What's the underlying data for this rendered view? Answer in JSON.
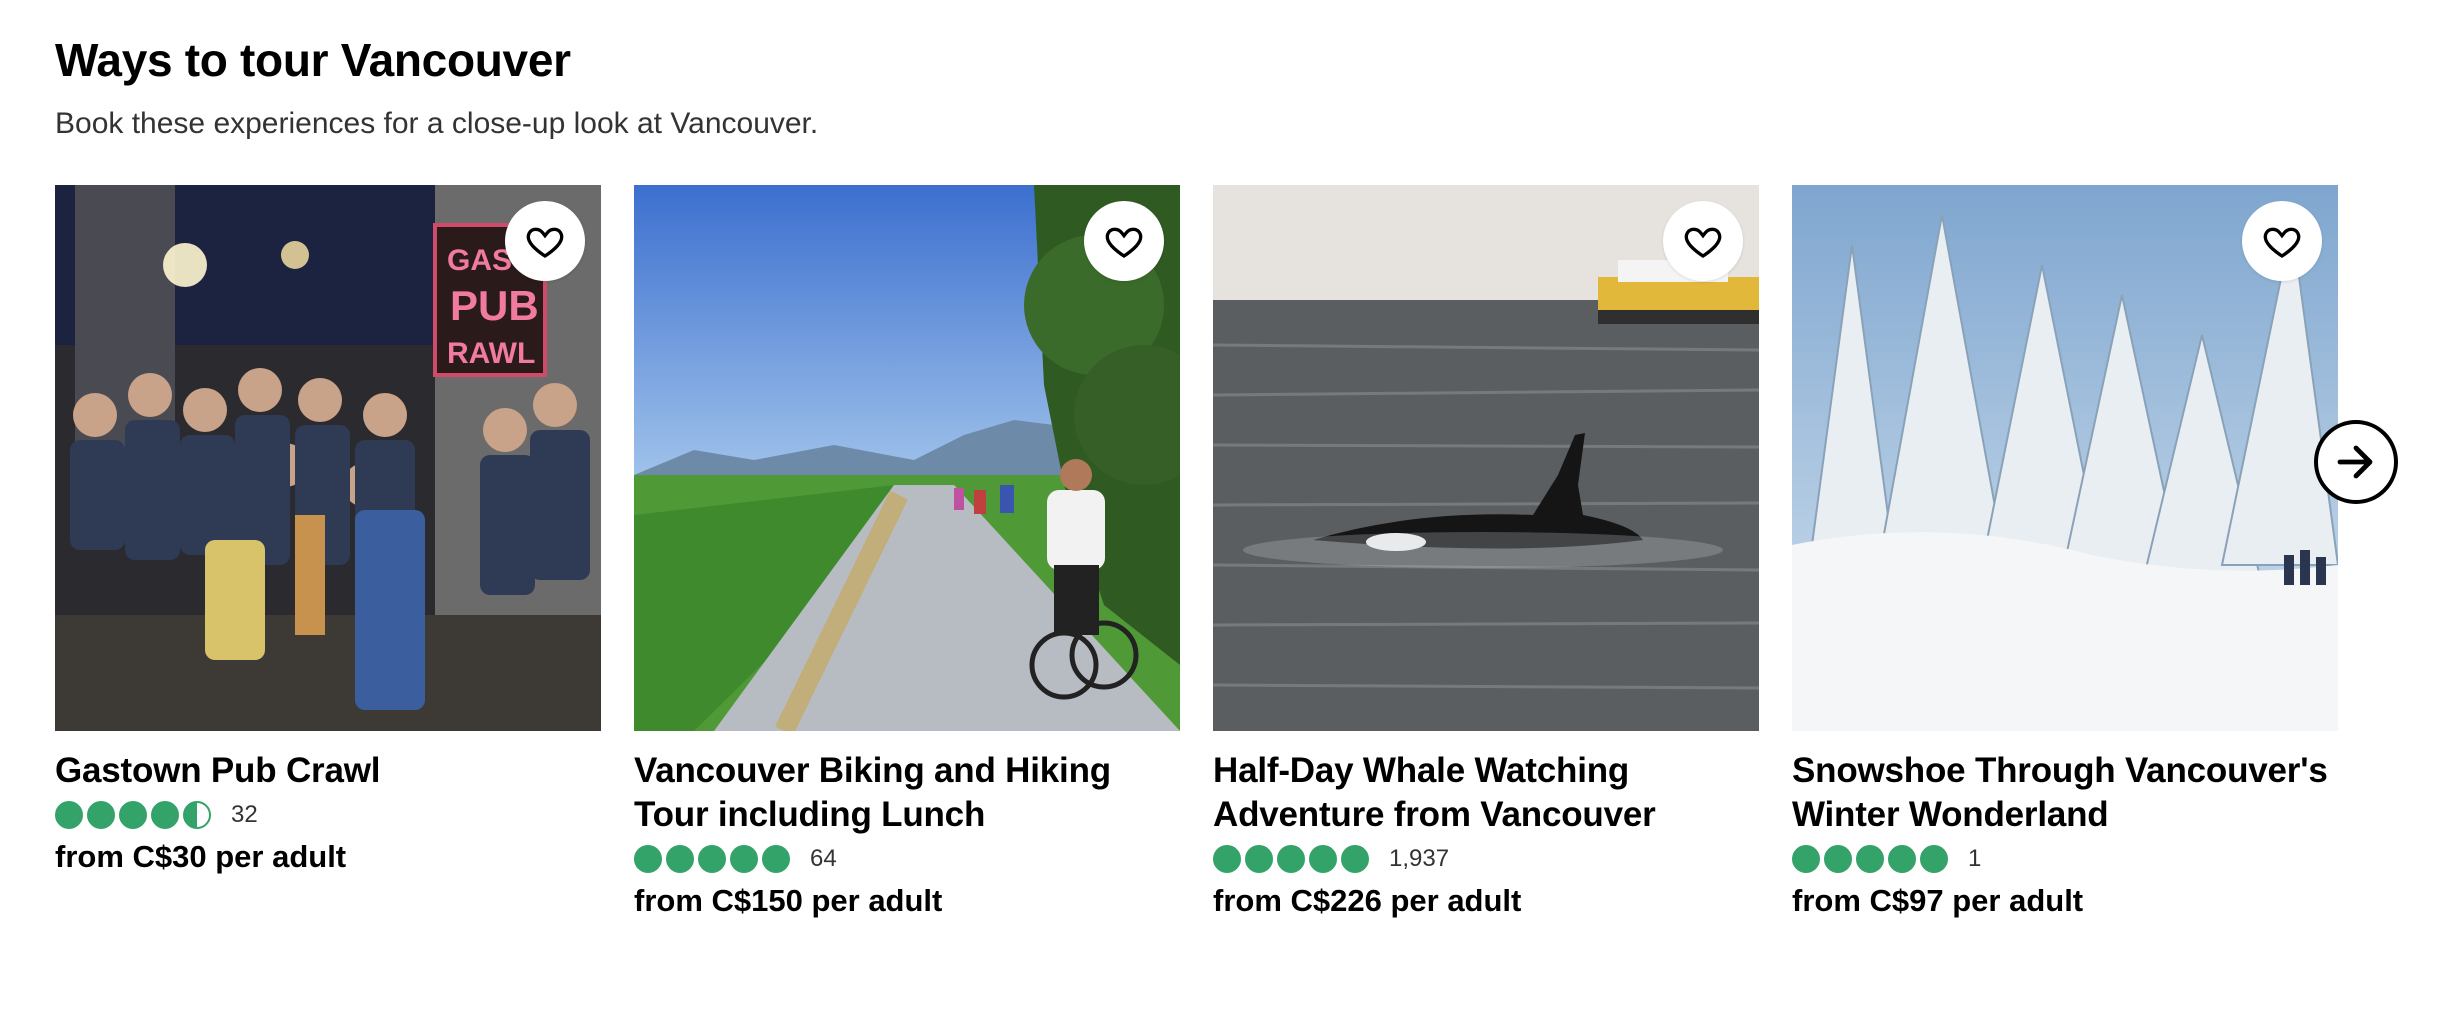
{
  "section": {
    "title": "Ways to tour Vancouver",
    "subtitle": "Book these experiences for a close-up look at Vancouver."
  },
  "cards": [
    {
      "name": "Gastown Pub Crawl",
      "rating": 4.5,
      "reviews": "32",
      "price": "from C$30 per adult",
      "sign_text": [
        "GAST",
        "PUB",
        "RAWL"
      ]
    },
    {
      "name": "Vancouver Biking and Hiking Tour including Lunch",
      "rating": 5,
      "reviews": "64",
      "price": "from C$150 per adult"
    },
    {
      "name": "Half-Day Whale Watching Adventure from Vancouver",
      "rating": 5,
      "reviews": "1,937",
      "price": "from C$226 per adult"
    },
    {
      "name": "Snowshoe Through Vancouver's Winter Wonderland",
      "rating": 5,
      "reviews": "1",
      "price": "from C$97 per adult"
    }
  ],
  "icons": {
    "favorite": "heart-outline-icon",
    "next": "arrow-right-icon",
    "rating": "rating-bubble-icon"
  },
  "colors": {
    "rating_green": "#34a36a",
    "text": "#000000",
    "subtext": "#333333"
  }
}
